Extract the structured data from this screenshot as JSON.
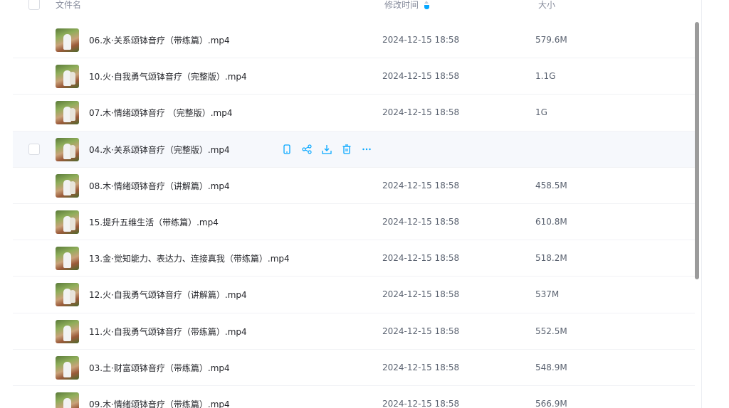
{
  "header": {
    "col_name": "文件名",
    "col_time": "修改时间",
    "col_size": "大小"
  },
  "accent_color": "#06a7ff",
  "files": [
    {
      "name": "06.水·关系颂钵音疗（带练篇）.mp4",
      "time": "2024-12-15 18:58",
      "size": "579.6M"
    },
    {
      "name": "10.火·自我勇气颂钵音疗（完整版）.mp4",
      "time": "2024-12-15 18:58",
      "size": "1.1G"
    },
    {
      "name": "07.木·情绪颂钵音疗 （完整版）.mp4",
      "time": "2024-12-15 18:58",
      "size": "1G"
    },
    {
      "name": "04.水·关系颂钵音疗（完整版）.mp4",
      "time": "",
      "size": ""
    },
    {
      "name": "08.木·情绪颂钵音疗（讲解篇）.mp4",
      "time": "2024-12-15 18:58",
      "size": "458.5M"
    },
    {
      "name": "15.提升五维生活（带练篇）.mp4",
      "time": "2024-12-15 18:58",
      "size": "610.8M"
    },
    {
      "name": "13.金·觉知能力、表达力、连接真我（带练篇）.mp4",
      "time": "2024-12-15 18:58",
      "size": "518.2M"
    },
    {
      "name": "12.火·自我勇气颂钵音疗（讲解篇）.mp4",
      "time": "2024-12-15 18:58",
      "size": "537M"
    },
    {
      "name": "11.火·自我勇气颂钵音疗（带练篇）.mp4",
      "time": "2024-12-15 18:58",
      "size": "552.5M"
    },
    {
      "name": "03.土·财富颂钵音疗（带练篇）.mp4",
      "time": "2024-12-15 18:58",
      "size": "548.9M"
    },
    {
      "name": "09.木·情绪颂钵音疗（带练篇）.mp4",
      "time": "2024-12-15 18:58",
      "size": "566.9M"
    }
  ],
  "hover_actions": [
    "phone-icon",
    "share-icon",
    "download-icon",
    "delete-icon",
    "more-icon"
  ]
}
